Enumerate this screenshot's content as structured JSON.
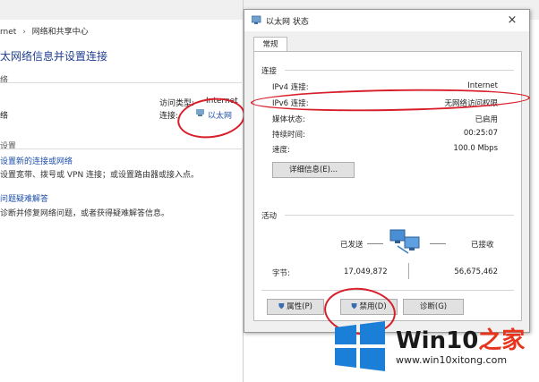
{
  "background": {
    "breadcrumb_1": "rnet",
    "breadcrumb_sep": "›",
    "breadcrumb_2": "网络和共享中心",
    "heading": "太网络信息并设置连接",
    "section_network": "络",
    "network_name": "络",
    "access_type_label": "访问类型:",
    "access_type_value": "Internet",
    "connections_label": "连接:",
    "connection_link": "以太网",
    "section_settings": "设置",
    "new_connection_link": "设置新的连接或网络",
    "new_connection_desc": "设置宽带、拨号或 VPN 连接；或设置路由器或接入点。",
    "troubleshoot_link": "问题疑难解答",
    "troubleshoot_desc": "诊断并修复网络问题，或者获得疑难解答信息。"
  },
  "dialog": {
    "title": "以太网 状态",
    "close": "×",
    "tab_general": "常规",
    "section_connection": "连接",
    "rows": [
      {
        "label": "IPv4 连接:",
        "value": "Internet"
      },
      {
        "label": "IPv6 连接:",
        "value": "无网络访问权限"
      },
      {
        "label": "媒体状态:",
        "value": "已启用"
      },
      {
        "label": "持续时间:",
        "value": "00:25:07"
      },
      {
        "label": "速度:",
        "value": "100.0 Mbps"
      }
    ],
    "details_button": "详细信息(E)...",
    "section_activity": "活动",
    "sent_label": "已发送",
    "received_label": "已接收",
    "bytes_label": "字节:",
    "bytes_sent": "17,049,872",
    "bytes_received": "56,675,462",
    "properties_button": "属性(P)",
    "disable_button": "禁用(D)",
    "diagnose_button": "诊断(G)"
  },
  "watermark": {
    "brand": "Win10",
    "brand_suffix": "之家",
    "url": "www.win10xitong.com"
  },
  "colors": {
    "annotation": "#d81e2a",
    "link": "#1f4fa8",
    "logo_blue": "#1b7fd8"
  }
}
